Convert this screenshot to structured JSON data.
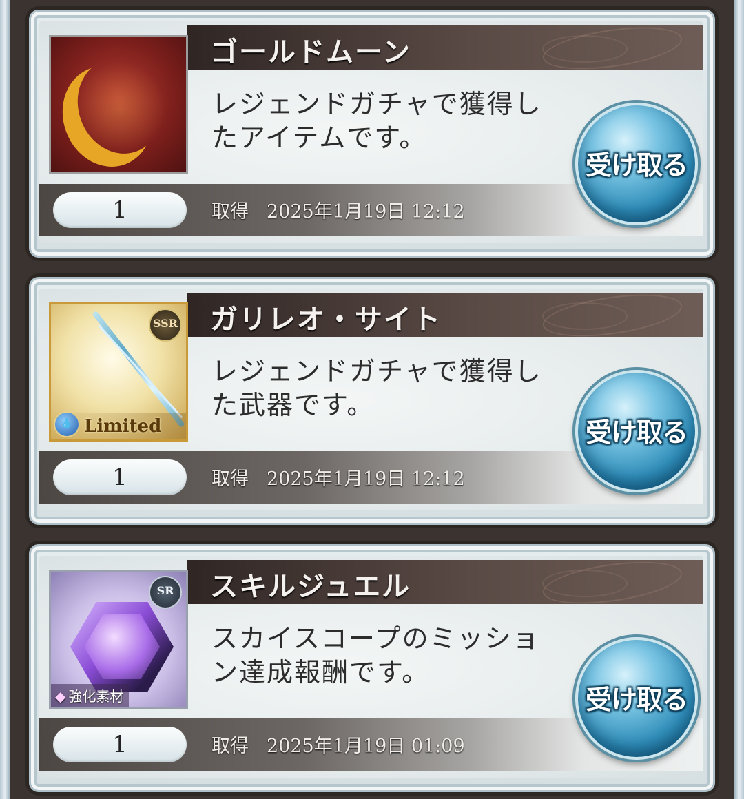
{
  "claim_label": "受け取る",
  "acquired_label": "取得",
  "items": [
    {
      "name": "ゴールドムーン",
      "desc_line1": "レジェンドガチャで獲得し",
      "desc_line2": "たアイテムです。",
      "count": "1",
      "date": "2025年1月19日 12:12",
      "icon": "gold-moon-icon"
    },
    {
      "name": "ガリレオ・サイト",
      "desc_line1": "レジェンドガチャで獲得し",
      "desc_line2": "た武器です。",
      "count": "1",
      "date": "2025年1月19日 12:12",
      "icon": "bow-weapon-icon",
      "rarity": "SSR",
      "tag": "Limited"
    },
    {
      "name": "スキルジュエル",
      "desc_line1": "スカイスコープのミッショ",
      "desc_line2": "ン達成報酬です。",
      "count": "1",
      "date": "2025年1月19日 01:09",
      "icon": "skill-jewel-icon",
      "rarity": "SR",
      "tag": "強化素材"
    }
  ],
  "colors": {
    "accent_button": "#2f8db8",
    "name_bar": "#2f2624",
    "frame": "#b9c9d3"
  }
}
